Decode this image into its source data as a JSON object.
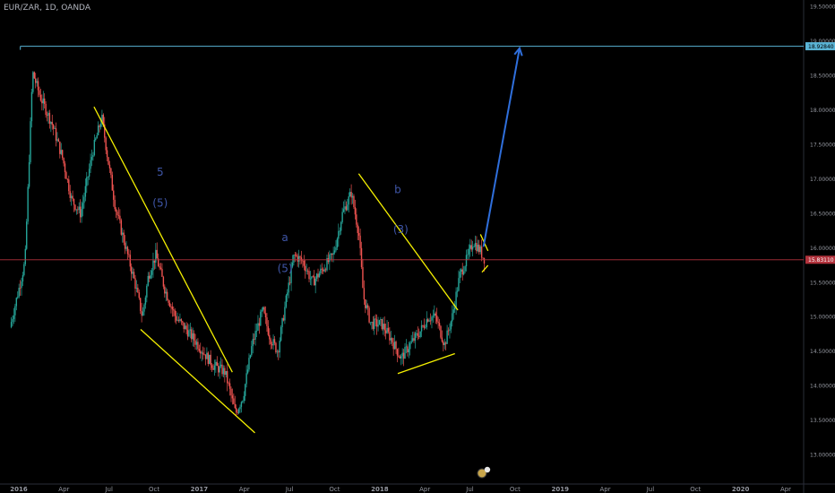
{
  "header": {
    "symbol": "EUR/ZAR, 1D, OANDA"
  },
  "chart_data": {
    "type": "candlestick",
    "title": "EUR/ZAR, 1D, OANDA",
    "ylim": [
      12.75,
      19.6
    ],
    "yticks": [
      "19.50000",
      "19.00000",
      "18.50000",
      "18.00000",
      "17.50000",
      "17.00000",
      "16.50000",
      "16.00000",
      "15.50000",
      "15.00000",
      "14.50000",
      "14.00000",
      "13.50000",
      "13.00000"
    ],
    "yticks_values": [
      19.5,
      19.0,
      18.5,
      18.0,
      17.5,
      17.0,
      16.5,
      16.0,
      15.5,
      15.0,
      14.5,
      14.0,
      13.5,
      13.0
    ],
    "xticks": [
      "2016",
      "Apr",
      "Jul",
      "Oct",
      "2017",
      "Apr",
      "Jul",
      "Oct",
      "2018",
      "Apr",
      "Jul",
      "Oct",
      "2019",
      "Apr",
      "Jul",
      "Oct",
      "2020",
      "Apr"
    ],
    "xticks_months": [
      0,
      3,
      6,
      9,
      12,
      15,
      18,
      21,
      24,
      27,
      30,
      33,
      36,
      39,
      42,
      45,
      48,
      51
    ],
    "bold_xticks": [
      "2016",
      "2017",
      "2018",
      "2019",
      "2020"
    ],
    "price_path": [
      [
        -0.5,
        14.85
      ],
      [
        0.5,
        15.8
      ],
      [
        1.0,
        18.55
      ],
      [
        1.5,
        18.2
      ],
      [
        2.3,
        17.8
      ],
      [
        3.0,
        17.3
      ],
      [
        3.6,
        16.7
      ],
      [
        4.2,
        16.5
      ],
      [
        5.0,
        17.4
      ],
      [
        5.6,
        17.9
      ],
      [
        6.0,
        17.3
      ],
      [
        6.5,
        16.6
      ],
      [
        7.2,
        16.0
      ],
      [
        7.8,
        15.5
      ],
      [
        8.3,
        15.0
      ],
      [
        8.7,
        15.6
      ],
      [
        9.2,
        15.9
      ],
      [
        9.8,
        15.4
      ],
      [
        10.5,
        15.0
      ],
      [
        11.3,
        14.8
      ],
      [
        12.0,
        14.6
      ],
      [
        13.0,
        14.3
      ],
      [
        13.8,
        14.2
      ],
      [
        14.5,
        13.6
      ],
      [
        15.0,
        13.85
      ],
      [
        15.6,
        14.6
      ],
      [
        16.3,
        15.1
      ],
      [
        16.8,
        14.7
      ],
      [
        17.3,
        14.5
      ],
      [
        17.9,
        15.3
      ],
      [
        18.4,
        15.9
      ],
      [
        19.0,
        15.8
      ],
      [
        19.6,
        15.5
      ],
      [
        20.3,
        15.7
      ],
      [
        21.0,
        15.9
      ],
      [
        21.6,
        16.5
      ],
      [
        22.2,
        16.8
      ],
      [
        22.7,
        16.2
      ],
      [
        23.0,
        15.3
      ],
      [
        23.5,
        14.9
      ],
      [
        24.2,
        14.9
      ],
      [
        24.8,
        14.7
      ],
      [
        25.5,
        14.4
      ],
      [
        26.1,
        14.6
      ],
      [
        26.8,
        14.8
      ],
      [
        27.3,
        15.0
      ],
      [
        27.8,
        15.0
      ],
      [
        28.4,
        14.6
      ],
      [
        28.9,
        15.0
      ],
      [
        29.4,
        15.6
      ],
      [
        29.9,
        15.85
      ],
      [
        30.3,
        16.1
      ],
      [
        30.8,
        15.95
      ],
      [
        31.0,
        15.85
      ]
    ],
    "last_price": 15.8311,
    "last_price_label": "15.83110",
    "horizontal_line": {
      "value": 18.9284,
      "label": "18.92840",
      "color": "#5ab4d6"
    },
    "current_price_line": {
      "value": 15.8311,
      "color": "#b2323c"
    },
    "trendlines": [
      {
        "from": [
          5.0,
          18.05
        ],
        "to": [
          14.2,
          14.2
        ],
        "color": "#f5f000"
      },
      {
        "from": [
          8.1,
          14.82
        ],
        "to": [
          15.7,
          13.32
        ],
        "color": "#f5f000"
      },
      {
        "from": [
          22.6,
          17.08
        ],
        "to": [
          29.2,
          15.1
        ],
        "color": "#f5f000"
      },
      {
        "from": [
          25.2,
          14.18
        ],
        "to": [
          29.0,
          14.47
        ],
        "color": "#f5f000"
      },
      {
        "from": [
          30.7,
          16.2
        ],
        "to": [
          31.2,
          15.96
        ],
        "color": "#f5f000"
      },
      {
        "from": [
          30.8,
          15.65
        ],
        "to": [
          31.2,
          15.75
        ],
        "color": "#f5f000"
      }
    ],
    "projection_arrow": {
      "from": [
        30.9,
        16.02
      ],
      "to": [
        33.3,
        18.9
      ],
      "color": "#2f6fdc"
    },
    "annotations": [
      {
        "text": "5",
        "at": [
          9.4,
          17.05
        ]
      },
      {
        "text": "(5)",
        "at": [
          9.4,
          16.6
        ]
      },
      {
        "text": "a",
        "at": [
          17.7,
          16.1
        ]
      },
      {
        "text": "(5)",
        "at": [
          17.7,
          15.65
        ]
      },
      {
        "text": "b",
        "at": [
          25.2,
          16.8
        ]
      },
      {
        "text": "(3)",
        "at": [
          25.4,
          16.22
        ]
      }
    ],
    "colors": {
      "up": "#26a69a",
      "down": "#ef5350",
      "wave_lines": "#f5f000",
      "projection": "#2f6fdc",
      "labels": "#3f56a8",
      "background": "#000000"
    }
  }
}
